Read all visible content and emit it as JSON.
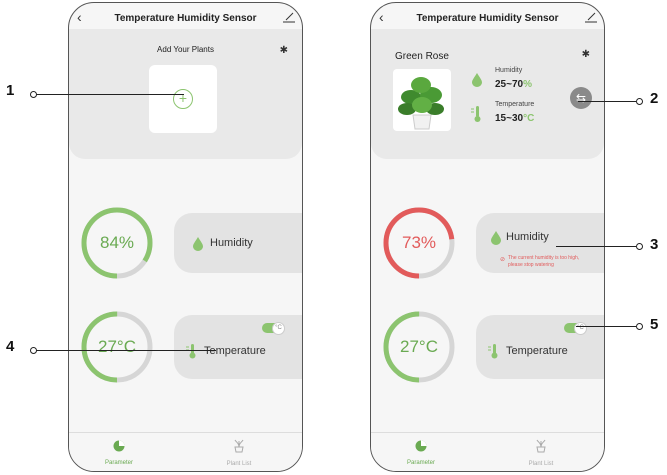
{
  "app": {
    "title": "Temperature Humidity Sensor"
  },
  "screen1": {
    "add_label": "Add Your Plants",
    "humidity": {
      "value_text": "84%",
      "level": 0.84,
      "label": "Humidity"
    },
    "temperature": {
      "value_text": "27°C",
      "level": 0.5,
      "label": "Temperature",
      "unit_toggle": "°C"
    }
  },
  "screen2": {
    "plant_name": "Green Rose",
    "range_humidity": {
      "label": "Humidity",
      "value": "25~70",
      "unit": "%"
    },
    "range_temperature": {
      "label": "Temperature",
      "value": "15~30",
      "unit": "°C"
    },
    "humidity": {
      "value_text": "73%",
      "level": 0.73,
      "label": "Humidity",
      "warning": "The current humidity is too high, please stop watering"
    },
    "temperature": {
      "value_text": "27°C",
      "level": 0.5,
      "label": "Temperature",
      "unit_toggle": "°C"
    }
  },
  "nav": {
    "parameter": "Parameter",
    "plant_list": "Plant List"
  },
  "callouts": {
    "c1": "1",
    "c2": "2",
    "c3": "3",
    "c4": "4",
    "c5": "5"
  },
  "colors": {
    "accent": "#8cc46f",
    "alert": "#e25b5b",
    "track": "#d6d6d6"
  },
  "icons": {
    "back": "chevron-left-icon",
    "edit": "pencil-icon",
    "bluetooth": "bluetooth-icon",
    "drop": "water-drop-icon",
    "thermo": "thermometer-icon",
    "swap": "swap-icon"
  }
}
